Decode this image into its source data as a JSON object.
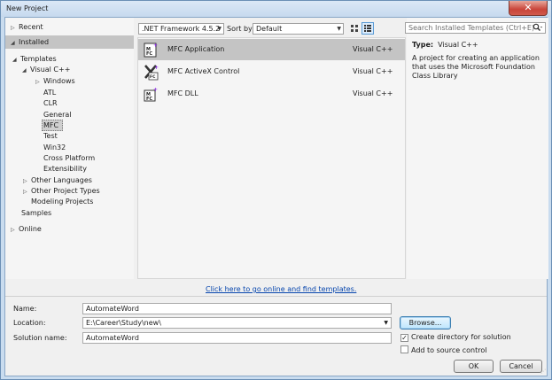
{
  "window": {
    "title": "New Project",
    "close_label": "✕"
  },
  "tree": {
    "recent": "Recent",
    "installed": "Installed",
    "templates": "Templates",
    "visual_cpp": "Visual C++",
    "items": [
      "Windows",
      "ATL",
      "CLR",
      "General",
      "MFC",
      "Test",
      "Win32",
      "Cross Platform",
      "Extensibility"
    ],
    "other_languages": "Other Languages",
    "other_project_types": "Other Project Types",
    "modeling_projects": "Modeling Projects",
    "samples": "Samples",
    "online": "Online"
  },
  "toolbar": {
    "framework": ".NET Framework 4.5.2",
    "sort_label": "Sort by:",
    "sort_value": "Default"
  },
  "search": {
    "placeholder": "Search Installed Templates (Ctrl+E)"
  },
  "templates": [
    {
      "name": "MFC Application",
      "lang": "Visual C++"
    },
    {
      "name": "MFC ActiveX Control",
      "lang": "Visual C++"
    },
    {
      "name": "MFC DLL",
      "lang": "Visual C++"
    }
  ],
  "online_link": "Click here to go online and find templates.",
  "details": {
    "type_label": "Type:",
    "type_value": "Visual C++",
    "description": "A project for creating an application that uses the Microsoft Foundation Class Library"
  },
  "form": {
    "name_label": "Name:",
    "name_value": "AutomateWord",
    "location_label": "Location:",
    "location_value": "E:\\Career\\Study\\new\\",
    "solution_label": "Solution name:",
    "solution_value": "AutomateWord",
    "browse": "Browse...",
    "create_dir": "Create directory for solution",
    "create_dir_checked": true,
    "source_control": "Add to source control",
    "source_control_checked": false,
    "ok": "OK",
    "cancel": "Cancel"
  },
  "icons": {
    "grid_view": "grid-view-icon",
    "list_view": "list-view-icon",
    "search": "search-icon",
    "mfc_app": "mfc-application-icon",
    "mfc_activex": "mfc-activex-icon",
    "mfc_dll": "mfc-dll-icon"
  }
}
